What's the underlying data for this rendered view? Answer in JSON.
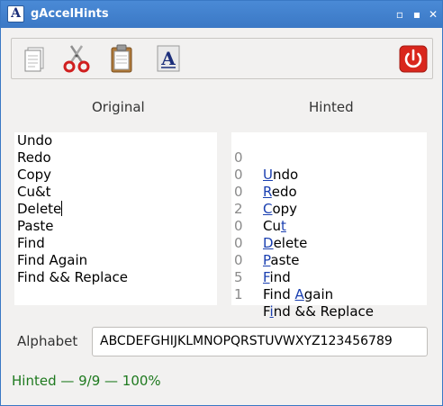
{
  "window": {
    "title": "gAccelHints"
  },
  "toolbar": {
    "buttons": [
      {
        "icon": "new-document-icon"
      },
      {
        "icon": "scissors-icon"
      },
      {
        "icon": "clipboard-icon"
      },
      {
        "icon": "font-icon",
        "glyph": "A"
      },
      {
        "icon": "power-icon"
      }
    ]
  },
  "original": {
    "header": "Original",
    "items": [
      "Undo",
      "Redo",
      "Copy",
      "Cu&t",
      "Delete",
      "Paste",
      "Find",
      "Find Again",
      "Find && Replace"
    ]
  },
  "hinted": {
    "header": "Hinted",
    "items": [
      {
        "count": "0",
        "pre": "",
        "key": "U",
        "post": "ndo"
      },
      {
        "count": "0",
        "pre": "",
        "key": "R",
        "post": "edo"
      },
      {
        "count": "0",
        "pre": "",
        "key": "C",
        "post": "opy"
      },
      {
        "count": "2",
        "pre": "Cu",
        "key": "t",
        "post": ""
      },
      {
        "count": "0",
        "pre": "",
        "key": "D",
        "post": "elete"
      },
      {
        "count": "0",
        "pre": "",
        "key": "P",
        "post": "aste"
      },
      {
        "count": "0",
        "pre": "",
        "key": "F",
        "post": "ind"
      },
      {
        "count": "5",
        "pre": "Find ",
        "key": "A",
        "post": "gain"
      },
      {
        "count": "1",
        "pre": "F",
        "key": "i",
        "post": "nd && Replace"
      }
    ]
  },
  "alphabet": {
    "label": "Alphabet",
    "value": "ABCDEFGHIJKLMNOPQRSTUVWXYZ123456789"
  },
  "status": {
    "text": "Hinted — 9/9 — 100%"
  },
  "colors": {
    "titlebar": "#3b78c5",
    "status": "#1f7a1f",
    "accelerator": "#1a3fb0",
    "power": "#d9261c"
  }
}
